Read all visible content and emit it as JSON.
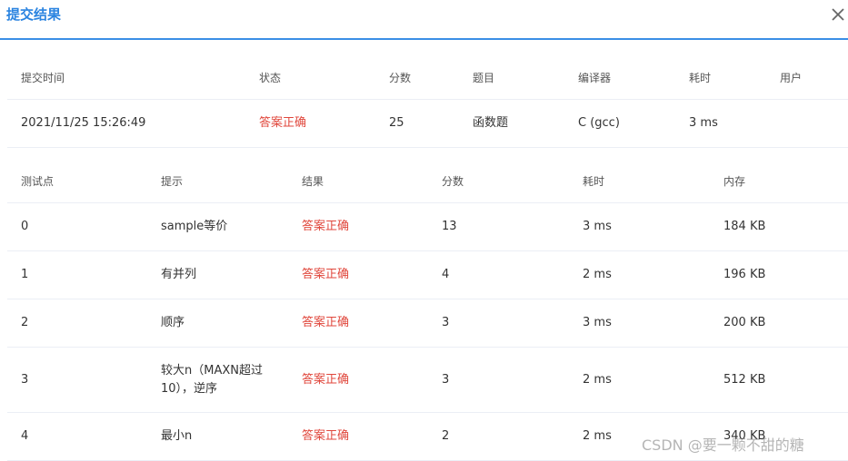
{
  "dialog": {
    "title": "提交结果",
    "close_icon": "close-icon"
  },
  "summary": {
    "headers": [
      "提交时间",
      "状态",
      "分数",
      "题目",
      "编译器",
      "耗时",
      "用户"
    ],
    "values": [
      "2021/11/25 15:26:49",
      "答案正确",
      "25",
      "函数题",
      "C (gcc)",
      "3 ms",
      ""
    ]
  },
  "testcases": {
    "headers": [
      "测试点",
      "提示",
      "结果",
      "分数",
      "耗时",
      "内存"
    ],
    "rows": [
      [
        "0",
        "sample等价",
        "答案正确",
        "13",
        "3 ms",
        "184 KB"
      ],
      [
        "1",
        "有并列",
        "答案正确",
        "4",
        "2 ms",
        "196 KB"
      ],
      [
        "2",
        "顺序",
        "答案正确",
        "3",
        "3 ms",
        "200 KB"
      ],
      [
        "3",
        "较大n（MAXN超过10），逆序",
        "答案正确",
        "3",
        "2 ms",
        "512 KB"
      ],
      [
        "4",
        "最小n",
        "答案正确",
        "2",
        "2 ms",
        "340 KB"
      ]
    ]
  },
  "colors": {
    "accent": "#3a8ee6",
    "accepted": "#e0473c"
  },
  "watermark": "CSDN @要一颗不甜的糖"
}
